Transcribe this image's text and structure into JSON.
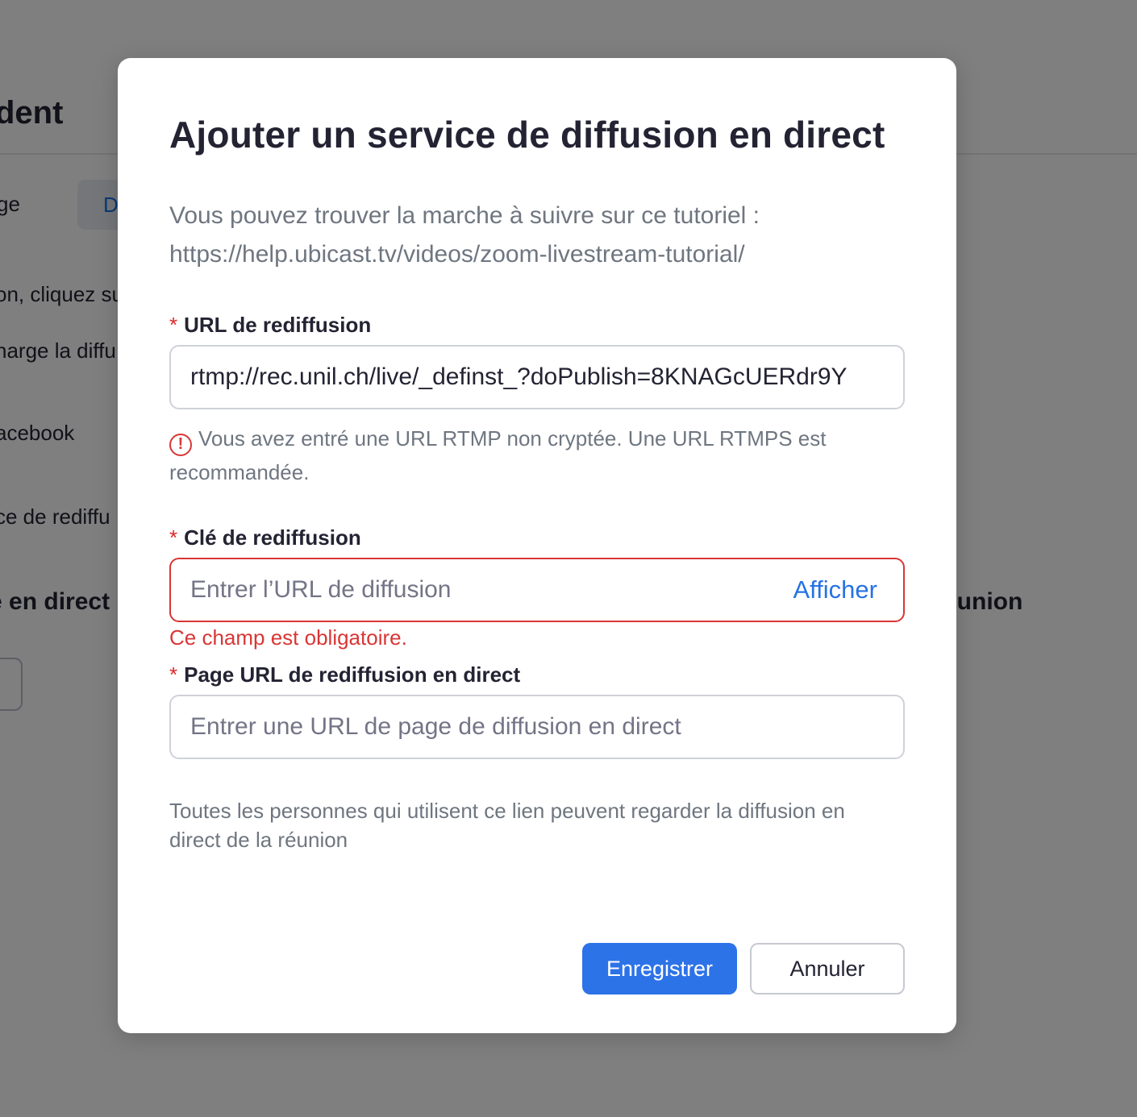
{
  "background": {
    "header_title": "dent",
    "tab_left": "ge",
    "tab_active": "D",
    "lines": [
      "on, cliquez su",
      "harge la diffu",
      "acebook",
      "ce de rediffu"
    ],
    "section_left": "e en direct p",
    "section_right": "éunion"
  },
  "modal": {
    "title": "Ajouter un service de diffusion en direct",
    "intro_line1": "Vous pouvez trouver la marche à suivre sur ce tutoriel :",
    "intro_line2": "https://help.ubicast.tv/videos/zoom-livestream-tutorial/",
    "required_mark": "*",
    "stream_url": {
      "label": "URL de rediffusion",
      "value": "rtmp://rec.unil.ch/live/_definst_?doPublish=8KNAGcUERdr9Y",
      "warning_icon": "alert-circle-icon",
      "warning": "Vous avez entré une URL RTMP non cryptée. Une URL RTMPS est recommandée."
    },
    "stream_key": {
      "label": "Clé de rediffusion",
      "placeholder": "Entrer l’URL de diffusion",
      "show_label": "Afficher",
      "error": "Ce champ est obligatoire."
    },
    "page_url": {
      "label": "Page URL de rediffusion en direct",
      "placeholder": "Entrer une URL de page de diffusion en direct",
      "help": "Toutes les personnes qui utilisent ce lien peuvent regarder la diffusion en direct de la réunion"
    },
    "buttons": {
      "save": "Enregistrer",
      "cancel": "Annuler"
    }
  },
  "colors": {
    "primary": "#2d73e8",
    "link": "#2772e4",
    "error": "#d93636",
    "required": "#de2828",
    "overlay": "rgba(0,0,0,0.5)"
  }
}
